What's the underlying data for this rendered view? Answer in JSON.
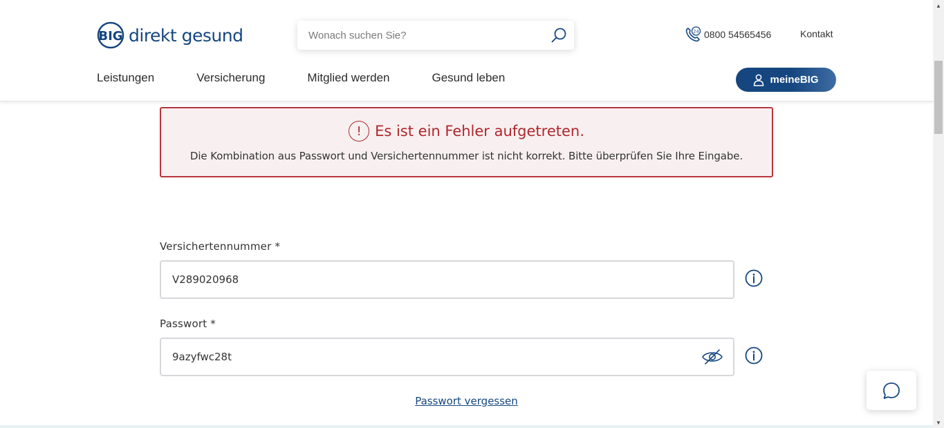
{
  "header": {
    "logo_text": "direkt gesund",
    "logo_mark": "BIG",
    "search": {
      "placeholder": "Wonach suchen Sie?",
      "icon": "search-icon"
    },
    "phone": {
      "number": "0800 54565456",
      "icon": "phone-24-icon"
    },
    "contact_label": "Kontakt",
    "nav": [
      {
        "label": "Leistungen"
      },
      {
        "label": "Versicherung"
      },
      {
        "label": "Mitglied werden"
      },
      {
        "label": "Gesund leben"
      }
    ],
    "account_button": {
      "label": "meineBIG",
      "icon": "user-icon"
    }
  },
  "error": {
    "title": "Es ist ein Fehler aufgetreten.",
    "message": "Die Kombination aus Passwort und Versichertennummer ist nicht korrekt. Bitte überprüfen Sie Ihre Eingabe.",
    "icon": "exclamation-circle-icon",
    "color": "#b0262d"
  },
  "form": {
    "insurance_number": {
      "label": "Versichertennummer *",
      "value": "V289020968"
    },
    "password": {
      "label": "Passwort *",
      "value": "9azyfwc28t",
      "toggle_icon": "eye-slash-icon"
    },
    "forgot_link": "Passwort vergessen"
  },
  "colors": {
    "brand": "#15467f",
    "error": "#b0262d",
    "error_bg": "#f8f0f0"
  }
}
